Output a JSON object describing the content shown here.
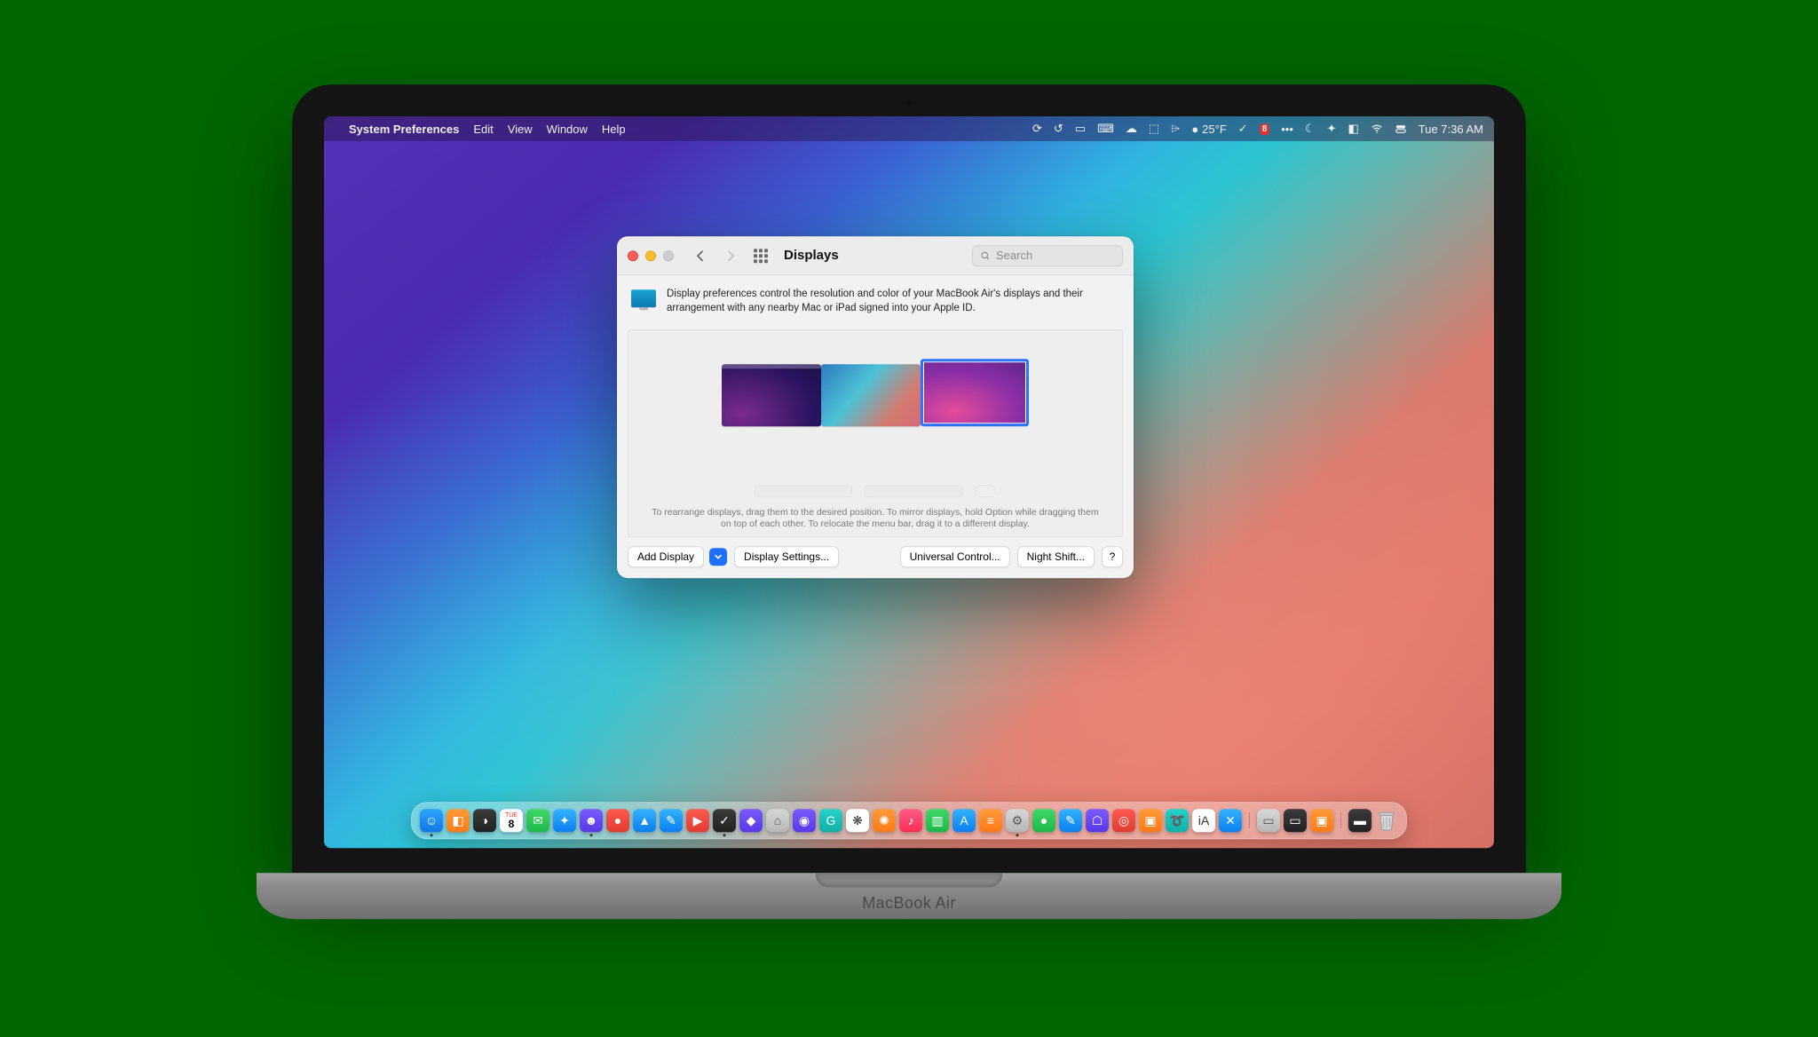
{
  "menubar": {
    "app": "System Preferences",
    "items": [
      "Edit",
      "View",
      "Window",
      "Help"
    ],
    "status": {
      "weather": "25°F",
      "calendar_day": "8",
      "clock": "Tue 7:36 AM"
    }
  },
  "window": {
    "title": "Displays",
    "search_placeholder": "Search",
    "description": "Display preferences control the resolution and color of your MacBook Air's displays and their arrangement with any nearby Mac or iPad signed into your Apple ID.",
    "arrangement_help": "To rearrange displays, drag them to the desired position. To mirror displays, hold Option while dragging them on top of each other. To relocate the menu bar, drag it to a different display.",
    "buttons": {
      "add_display": "Add Display",
      "display_settings": "Display Settings...",
      "universal_control": "Universal Control...",
      "night_shift": "Night Shift...",
      "help": "?"
    }
  },
  "dock": {
    "calendar_day": "8"
  },
  "hardware": {
    "deck_label": "MacBook Air"
  }
}
